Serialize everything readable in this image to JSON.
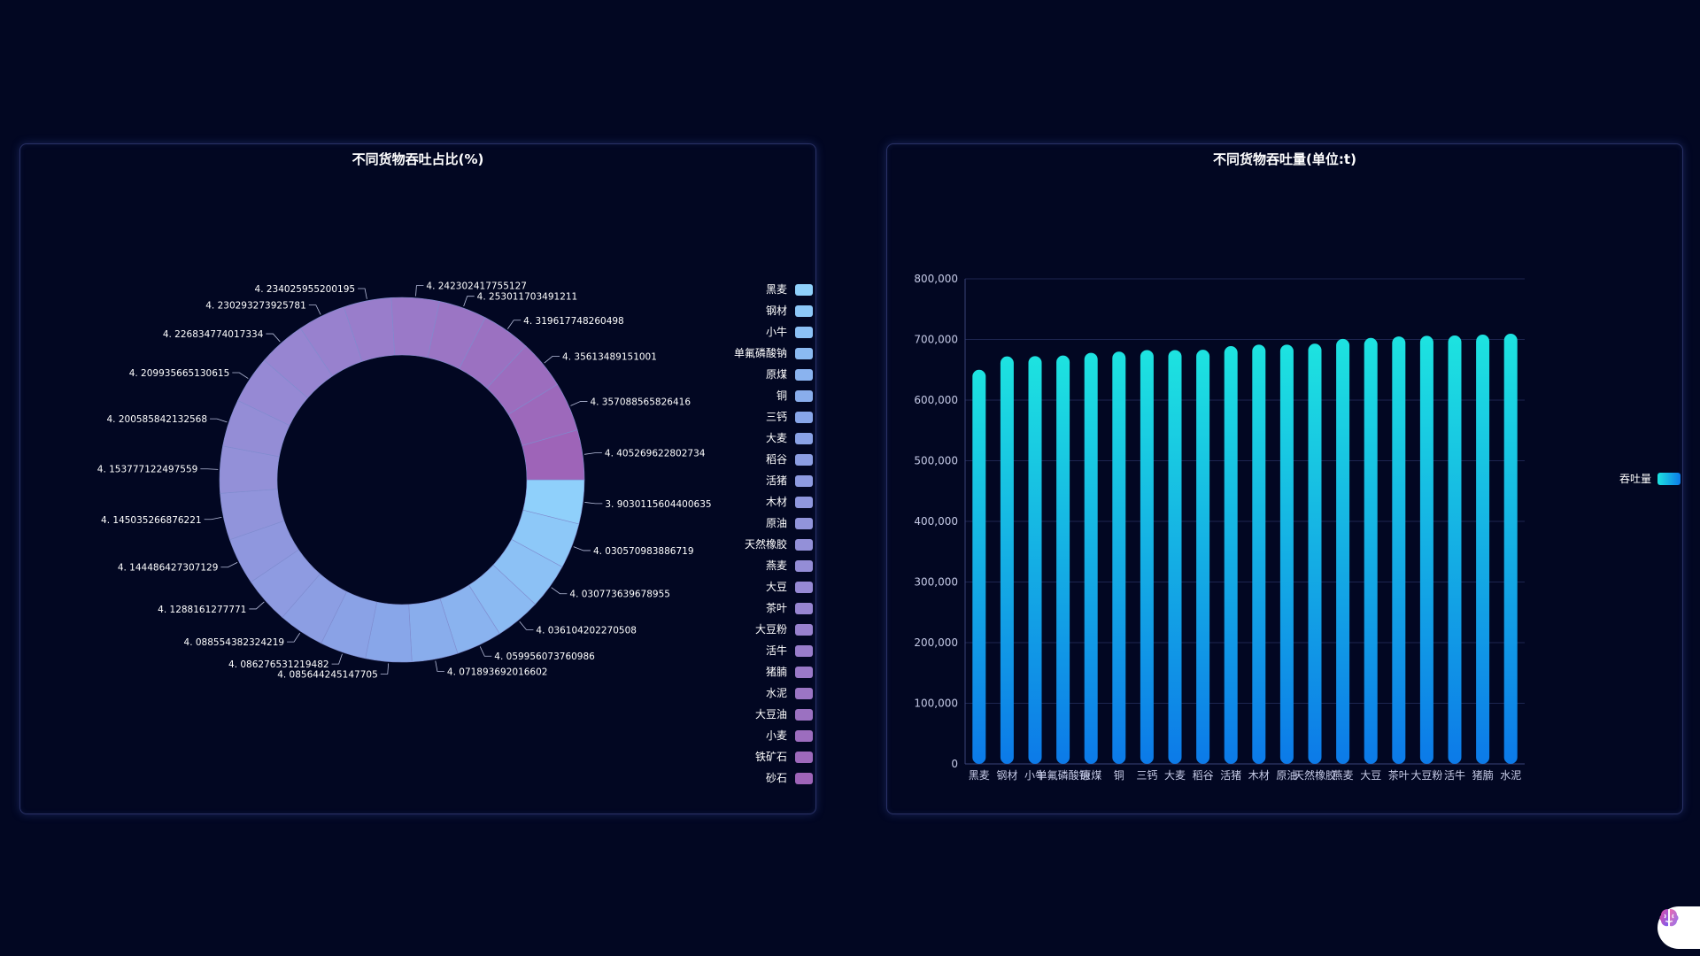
{
  "chart_data": [
    {
      "type": "pie",
      "title": "不同货物吞吐占比(%)",
      "donut": true,
      "legend_position": "right",
      "categories": [
        "黑麦",
        "钢材",
        "小牛",
        "单氟磷酸钠",
        "原煤",
        "铜",
        "三钙",
        "大麦",
        "稻谷",
        "活猪",
        "木材",
        "原油",
        "天然橡胶",
        "燕麦",
        "大豆",
        "茶叶",
        "大豆粉",
        "活牛",
        "猪腩",
        "水泥",
        "大豆油",
        "小麦",
        "铁矿石",
        "砂石"
      ],
      "values": [
        3.9030115604400635,
        4.030570983886719,
        4.030773639678955,
        4.036104202270508,
        4.059956073760986,
        4.071893692016602,
        4.085644245147705,
        4.086276531219482,
        4.088554382324219,
        4.1288161277771,
        4.144486427307129,
        4.145035266876221,
        4.153777122497559,
        4.200585842132568,
        4.209935665130615,
        4.226834774017334,
        4.230293273925781,
        4.234025955200195,
        4.242302417755127,
        4.253011703491211,
        4.319617748260498,
        4.35613489151001,
        4.357088565826416,
        4.405269622802734
      ],
      "value_labels": [
        "3. 9030115604400635",
        "4. 030570983886719",
        "4. 030773639678955",
        "4. 036104202270508",
        "4. 059956073760986",
        "4. 071893692016602",
        "4. 085644245147705",
        "4. 086276531219482",
        "4. 088554382324219",
        "4. 1288161277771",
        "4. 144486427307129",
        "4. 145035266876221",
        "4. 153777122497559",
        "4. 200585842132568",
        "4. 209935665130615",
        "4. 226834774017334",
        "4. 230293273925781",
        "4. 234025955200195",
        "4. 242302417755127",
        "4. 253011703491211",
        "4. 319617748260498",
        "4. 35613489151001",
        "4. 357088565826416",
        "4. 405269622802734"
      ],
      "colors": [
        "#8fd0fb",
        "#8dc8f8",
        "#8cc1f5",
        "#8bbaf2",
        "#8ab3ef",
        "#89adec",
        "#88a6e9",
        "#8aa2e6",
        "#8c9ee3",
        "#8e9be1",
        "#8f97de",
        "#9194db",
        "#9390d8",
        "#948dd6",
        "#9689d4",
        "#9785d1",
        "#9881ce",
        "#997dcb",
        "#9a79c8",
        "#9b75c4",
        "#9b71c1",
        "#9c6dbe",
        "#9d69bb",
        "#9e64b8"
      ],
      "legend": [
        {
          "label": "黑麦",
          "color": "#8fd0fb"
        },
        {
          "label": "钢材",
          "color": "#8dc8f8"
        },
        {
          "label": "小牛",
          "color": "#8cc1f5"
        },
        {
          "label": "单氟磷酸钠",
          "color": "#8bbaf2"
        },
        {
          "label": "原煤",
          "color": "#8ab3ef"
        },
        {
          "label": "铜",
          "color": "#89adec"
        },
        {
          "label": "三钙",
          "color": "#88a6e9"
        },
        {
          "label": "大麦",
          "color": "#8aa2e6"
        },
        {
          "label": "稻谷",
          "color": "#8c9ee3"
        },
        {
          "label": "活猪",
          "color": "#8e9be1"
        },
        {
          "label": "木材",
          "color": "#8f97de"
        },
        {
          "label": "原油",
          "color": "#9194db"
        },
        {
          "label": "天然橡胶",
          "color": "#9390d8"
        },
        {
          "label": "燕麦",
          "color": "#948dd6"
        },
        {
          "label": "大豆",
          "color": "#9689d4"
        },
        {
          "label": "茶叶",
          "color": "#9785d1"
        },
        {
          "label": "大豆粉",
          "color": "#9881ce"
        },
        {
          "label": "活牛",
          "color": "#997dcb"
        },
        {
          "label": "猪腩",
          "color": "#9a79c8"
        },
        {
          "label": "水泥",
          "color": "#9b75c4"
        },
        {
          "label": "大豆油",
          "color": "#9b71c1"
        },
        {
          "label": "小麦",
          "color": "#9c6dbe"
        },
        {
          "label": "铁矿石",
          "color": "#9d69bb"
        },
        {
          "label": "砂石",
          "color": "#9e64b8"
        }
      ]
    },
    {
      "type": "bar",
      "title": "不同货物吞吐量(单位:t)",
      "categories": [
        "黑麦",
        "钢材",
        "小牛",
        "单氟磷酸钠",
        "原煤",
        "铜",
        "三钙",
        "大麦",
        "稻谷",
        "活猪",
        "木材",
        "原油",
        "天然橡胶",
        "燕麦",
        "大豆",
        "茶叶",
        "大豆粉",
        "活牛",
        "猪腩",
        "水泥"
      ],
      "series": [
        {
          "name": "吞吐量",
          "values": [
            650000,
            672000,
            672500,
            673500,
            678000,
            680000,
            682500,
            682500,
            683000,
            689000,
            691500,
            691500,
            693000,
            701000,
            702500,
            705000,
            706000,
            706500,
            708000,
            709500
          ]
        }
      ],
      "ylim": [
        0,
        800000
      ],
      "yticks": [
        "0",
        "100,000",
        "200,000",
        "300,000",
        "400,000",
        "500,000",
        "600,000",
        "700,000",
        "800,000"
      ],
      "grid": true,
      "legend_position": "right",
      "colors": {
        "bar_top": "#1de3e0",
        "bar_bottom": "#0c7ae8",
        "axis": "#3a4378",
        "grid": "#1d2550",
        "tick_text": "#c5cae6"
      }
    }
  ]
}
